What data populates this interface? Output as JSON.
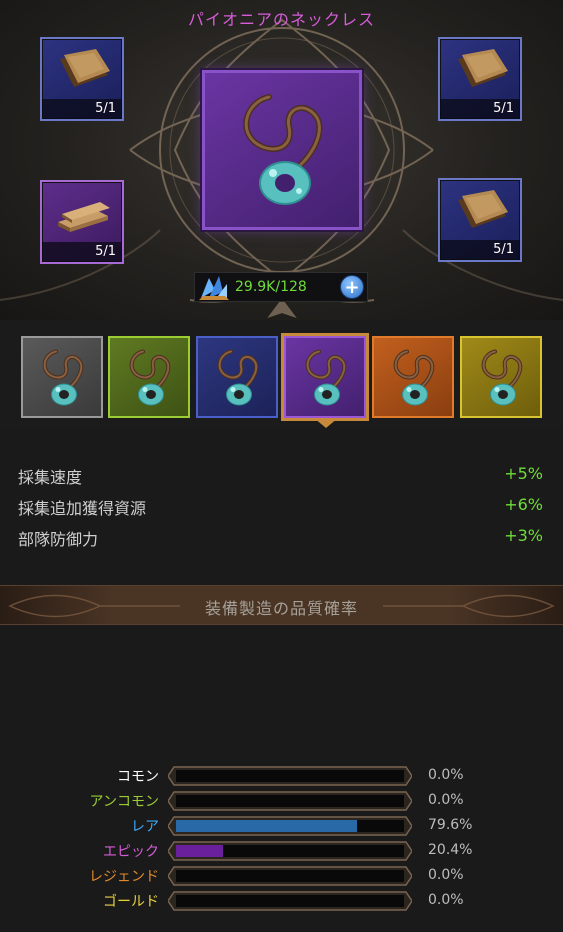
{
  "title": "パイオニアのネックレス",
  "materials": [
    {
      "icon": "leather-icon",
      "count": "5/1"
    },
    {
      "icon": "wood-plank-icon",
      "count": "5/1"
    },
    {
      "icon": "leather-icon",
      "count": "5/1"
    },
    {
      "icon": "leather-icon",
      "count": "5/1"
    }
  ],
  "main_item": {
    "icon": "necklace-icon"
  },
  "resource": {
    "icon": "crystal-icon",
    "value": "29.9K/128",
    "add_label": "+"
  },
  "quality_tiers": [
    {
      "name": "common",
      "color": "#9a9a9a"
    },
    {
      "name": "uncommon",
      "color": "#9acd32"
    },
    {
      "name": "rare",
      "color": "#4a5fc8"
    },
    {
      "name": "epic",
      "color": "#9b59d6",
      "selected": true
    },
    {
      "name": "legend",
      "color": "#e07b2c"
    },
    {
      "name": "gold",
      "color": "#d8c430"
    }
  ],
  "stats": [
    {
      "label": "採集速度",
      "value": "+5%"
    },
    {
      "label": "採集追加獲得資源",
      "value": "+6%"
    },
    {
      "label": "部隊防御力",
      "value": "+3%"
    }
  ],
  "probability_section": {
    "title": "装備製造の品質確率"
  },
  "probabilities": [
    {
      "label": "コモン",
      "pct": "0.0%",
      "fraction": 0.0,
      "label_color": "#ffffff",
      "bar_color": "#777777"
    },
    {
      "label": "アンコモン",
      "pct": "0.0%",
      "fraction": 0.0,
      "label_color": "#9acd32",
      "bar_color": "#6c9a25"
    },
    {
      "label": "レア",
      "pct": "79.6%",
      "fraction": 0.796,
      "label_color": "#3fa9f5",
      "bar_color": "#2a69a8"
    },
    {
      "label": "エピック",
      "pct": "20.4%",
      "fraction": 0.204,
      "label_color": "#d65cd8",
      "bar_color": "#6a1f9c"
    },
    {
      "label": "レジェンド",
      "pct": "0.0%",
      "fraction": 0.0,
      "label_color": "#e08a2c",
      "bar_color": "#c06a1c"
    },
    {
      "label": "ゴールド",
      "pct": "0.0%",
      "fraction": 0.0,
      "label_color": "#e8d23c",
      "bar_color": "#c0aa20"
    }
  ]
}
